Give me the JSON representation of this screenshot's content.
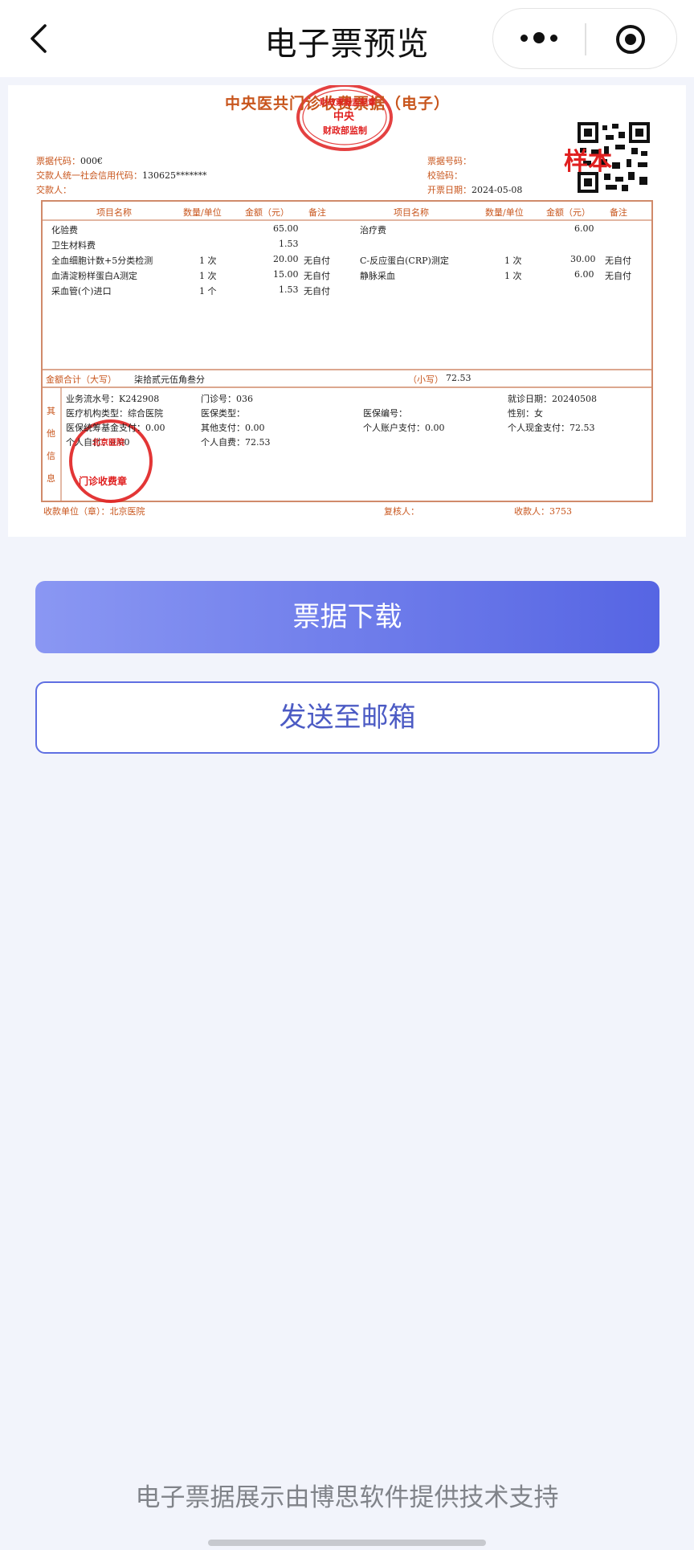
{
  "nav": {
    "title": "电子票预览",
    "back_icon": "chevron-left-icon",
    "more_icon": "more-dots-icon",
    "target_icon": "target-icon"
  },
  "receipt": {
    "title": "中央医共门诊收费票据（电子）",
    "bill_code_label": "票据代码：",
    "bill_code_value": "000€",
    "payer_credit_code_label": "交款人统一社会信用代码：",
    "payer_credit_code_value": "130625*******",
    "payer_label": "交款人：",
    "bill_no_label": "票据号码：",
    "bill_no_value": "",
    "check_code_label": "校验码：",
    "issue_date_label": "开票日期：",
    "issue_date_value": "2024-05-08",
    "sample_watermark": "样本",
    "headers": [
      "项目名称",
      "数量/单位",
      "金额（元）",
      "备注",
      "项目名称",
      "数量/单位",
      "金额（元）",
      "备注"
    ],
    "left_items": [
      {
        "name": "化验费",
        "qty": "",
        "amount": "65.00",
        "note": ""
      },
      {
        "name": "卫生材料费",
        "qty": "",
        "amount": "1.53",
        "note": ""
      },
      {
        "name": "全血细胞计数+5分类检测",
        "qty": "1 次",
        "amount": "20.00",
        "note": "无自付"
      },
      {
        "name": "血清淀粉样蛋白A测定",
        "qty": "1 次",
        "amount": "15.00",
        "note": "无自付"
      },
      {
        "name": "采血管(个)进口",
        "qty": "1 个",
        "amount": "1.53",
        "note": "无自付"
      }
    ],
    "right_items": [
      {
        "name": "治疗费",
        "qty": "",
        "amount": "6.00",
        "note": ""
      },
      {
        "name": "C-反应蛋白(CRP)测定",
        "qty": "1 次",
        "amount": "30.00",
        "note": "无自付"
      },
      {
        "name": "静脉采血",
        "qty": "1 次",
        "amount": "6.00",
        "note": "无自付"
      }
    ],
    "total_label": "金额合计（大写）",
    "total_upper": "柒拾贰元伍角叁分",
    "total_small_label": "（小写）",
    "total_small": "72.53",
    "other_info_label": "其他信息",
    "biz_serial": "业务流水号：K242908",
    "clinic_no": "门诊号：036",
    "visit_date": "就诊日期：20240508",
    "org_type": "医疗机构类型：综合医院",
    "insurance_type": "医保类型：",
    "insurance_no": "医保编号：",
    "gender": "性别：女",
    "fund_pay": "医保统筹基金支付：0.00",
    "other_pay": "其他支付：0.00",
    "personal_account_pay": "个人账户支付：0.00",
    "personal_cash_pay": "个人现金支付：72.53",
    "personal_pay": "个人自付：0.00",
    "personal_self": "个人自费：72.53",
    "payee_unit": "收款单位（章）：北京医院",
    "reviewer": "复核人：",
    "payee": "收款人：3753",
    "stamp_top_text": "财政票据监制章",
    "stamp_mid_text": "中央",
    "stamp_bottom_text": "财政部监制",
    "stamp2_text": "门诊收费章",
    "stamp2_top": "北京医院"
  },
  "buttons": {
    "download": "票据下载",
    "send_email": "发送至邮箱"
  },
  "footer": "电子票据展示由博思软件提供技术支持",
  "colors": {
    "accent": "#5665e3",
    "receipt_red": "#c8551c",
    "stamp_red": "#e02020"
  }
}
